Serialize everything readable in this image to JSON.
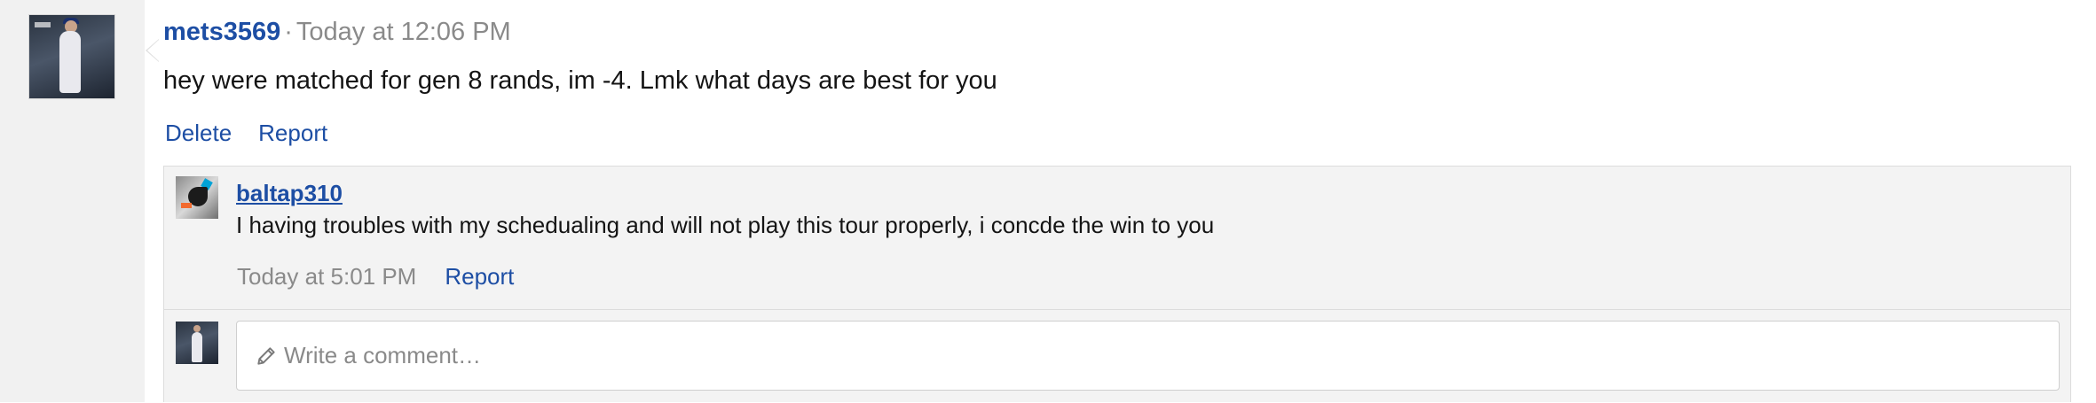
{
  "post": {
    "username": "mets3569",
    "separator": "·",
    "timestamp": "Today at 12:06 PM",
    "message": "hey were matched for gen 8 rands, im -4. Lmk what days are best for you",
    "actions": {
      "delete_label": "Delete",
      "report_label": "Report"
    }
  },
  "reply": {
    "username": "baltap310",
    "message": "I having troubles with my schedualing and will not play this tour properly, i concde the win to you",
    "timestamp": "Today at 5:01 PM",
    "report_label": "Report"
  },
  "composer": {
    "placeholder": "Write a comment…",
    "icon": "pencil-icon"
  },
  "colors": {
    "link": "#1d4ea4",
    "muted": "#8a8a8a",
    "comment_bg": "#f3f3f3",
    "rail_bg": "#f1f1f1"
  }
}
